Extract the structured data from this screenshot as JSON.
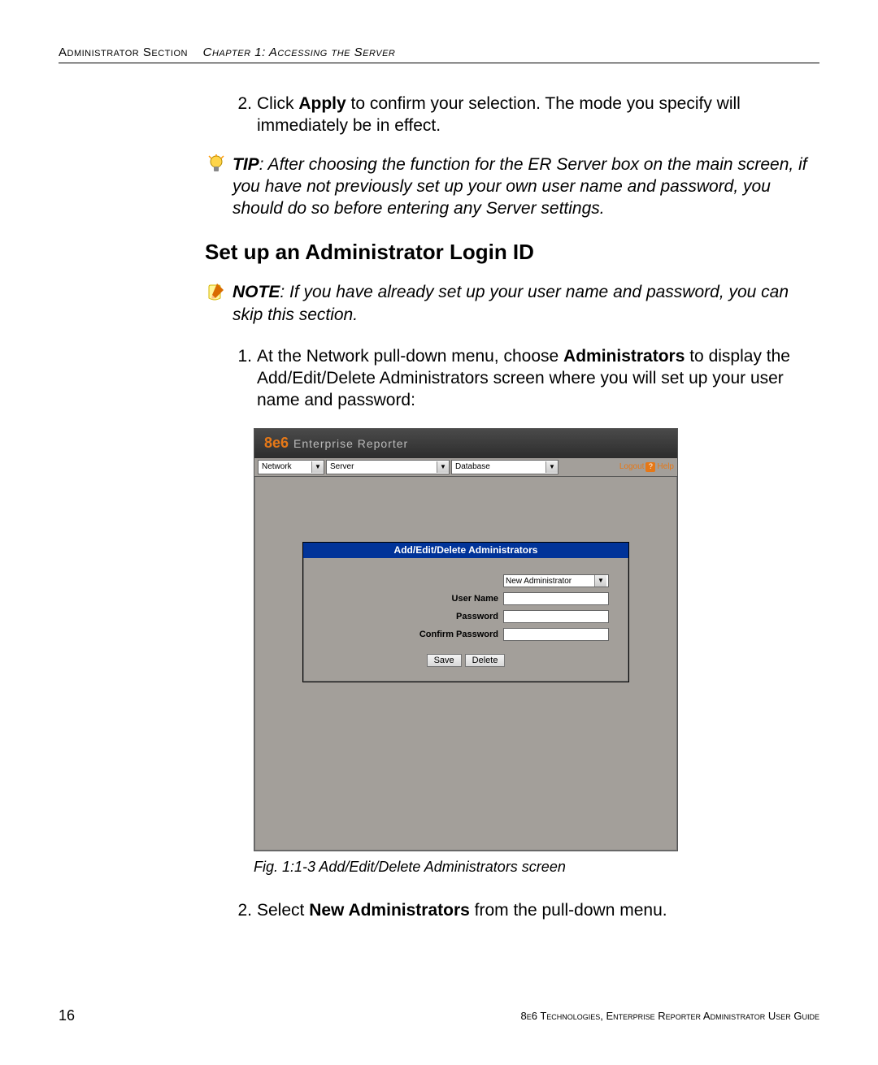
{
  "header": {
    "section": "Administrator Section",
    "chapter": "Chapter 1: Accessing the Server"
  },
  "step2a": {
    "num": "2.",
    "pre": "Click ",
    "bold": "Apply",
    "post": " to confirm your selection. The mode you specify will immediately be in effect."
  },
  "tip": {
    "label": "TIP",
    "text": ": After choosing the function for the ER Server box on the main screen, if you have not previously set up your own user name and password, you should do so before entering any Server settings."
  },
  "heading": "Set up an Administrator Login ID",
  "note": {
    "label": "NOTE",
    "text": ": If you have already set up your user name and password, you can skip this section."
  },
  "step1": {
    "num": "1.",
    "pre": "At the Network pull-down menu, choose ",
    "bold": "Administrators",
    "post": " to display the Add/Edit/Delete Administrators screen where you will set up your user name and password:"
  },
  "app": {
    "logo": "8e6",
    "title": "Enterprise Reporter",
    "menus": {
      "network": "Network",
      "server": "Server",
      "database": "Database"
    },
    "links": {
      "logout": "Logout",
      "help": "Help"
    },
    "panel": {
      "title": "Add/Edit/Delete Administrators",
      "dd_value": "New Administrator",
      "labels": {
        "username": "User Name",
        "password": "Password",
        "confirm": "Confirm Password"
      },
      "buttons": {
        "save": "Save",
        "delete": "Delete"
      }
    }
  },
  "fig_caption": "Fig. 1:1-3  Add/Edit/Delete Administrators screen",
  "step2b": {
    "num": "2.",
    "pre": "Select ",
    "bold": "New Administrators",
    "post": " from the pull-down menu."
  },
  "footer": {
    "page": "16",
    "text": "8e6 Technologies, Enterprise Reporter Administrator User Guide"
  }
}
